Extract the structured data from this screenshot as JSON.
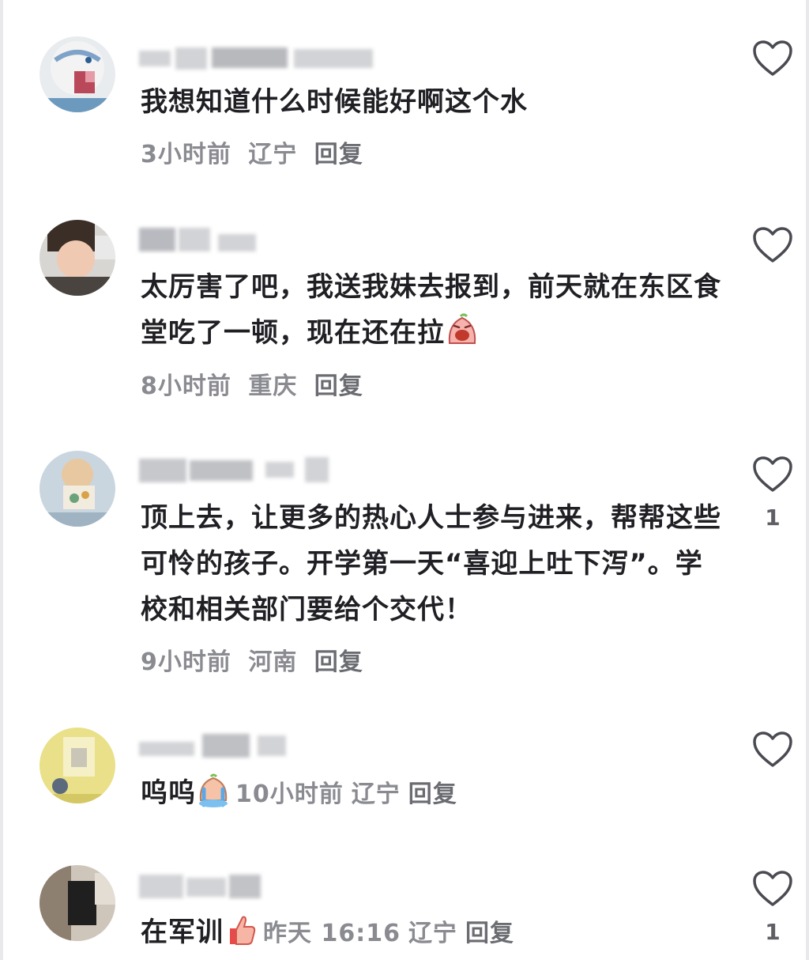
{
  "comments": [
    {
      "text": "我想知道什么时候能好啊这个水",
      "time": "3小时前",
      "location": "辽宁",
      "reply": "回复",
      "likes": ""
    },
    {
      "text": "太厉害了吧，我送我妹去报到，前天就在东区食堂吃了一顿，现在还在拉",
      "time": "8小时前",
      "location": "重庆",
      "reply": "回复",
      "likes": "",
      "emoji": "crying-face-icon"
    },
    {
      "text": "顶上去，让更多的热心人士参与进来，帮帮这些可怜的孩子。开学第一天“喜迎上吐下泻”。学校和相关部门要给个交代！",
      "time": "9小时前",
      "location": "河南",
      "reply": "回复",
      "likes": "1"
    },
    {
      "text": "呜呜",
      "time": "10小时前",
      "location": "辽宁",
      "reply": "回复",
      "likes": "",
      "emoji": "sobbing-face-icon"
    },
    {
      "text": "在军训",
      "time": "昨天 16:16",
      "location": "辽宁",
      "reply": "回复",
      "likes": "1",
      "emoji": "thumbs-up-icon"
    }
  ],
  "colors": {
    "text": "#1f1f24",
    "meta": "#8a8b91",
    "heart": "#4a4b52"
  }
}
